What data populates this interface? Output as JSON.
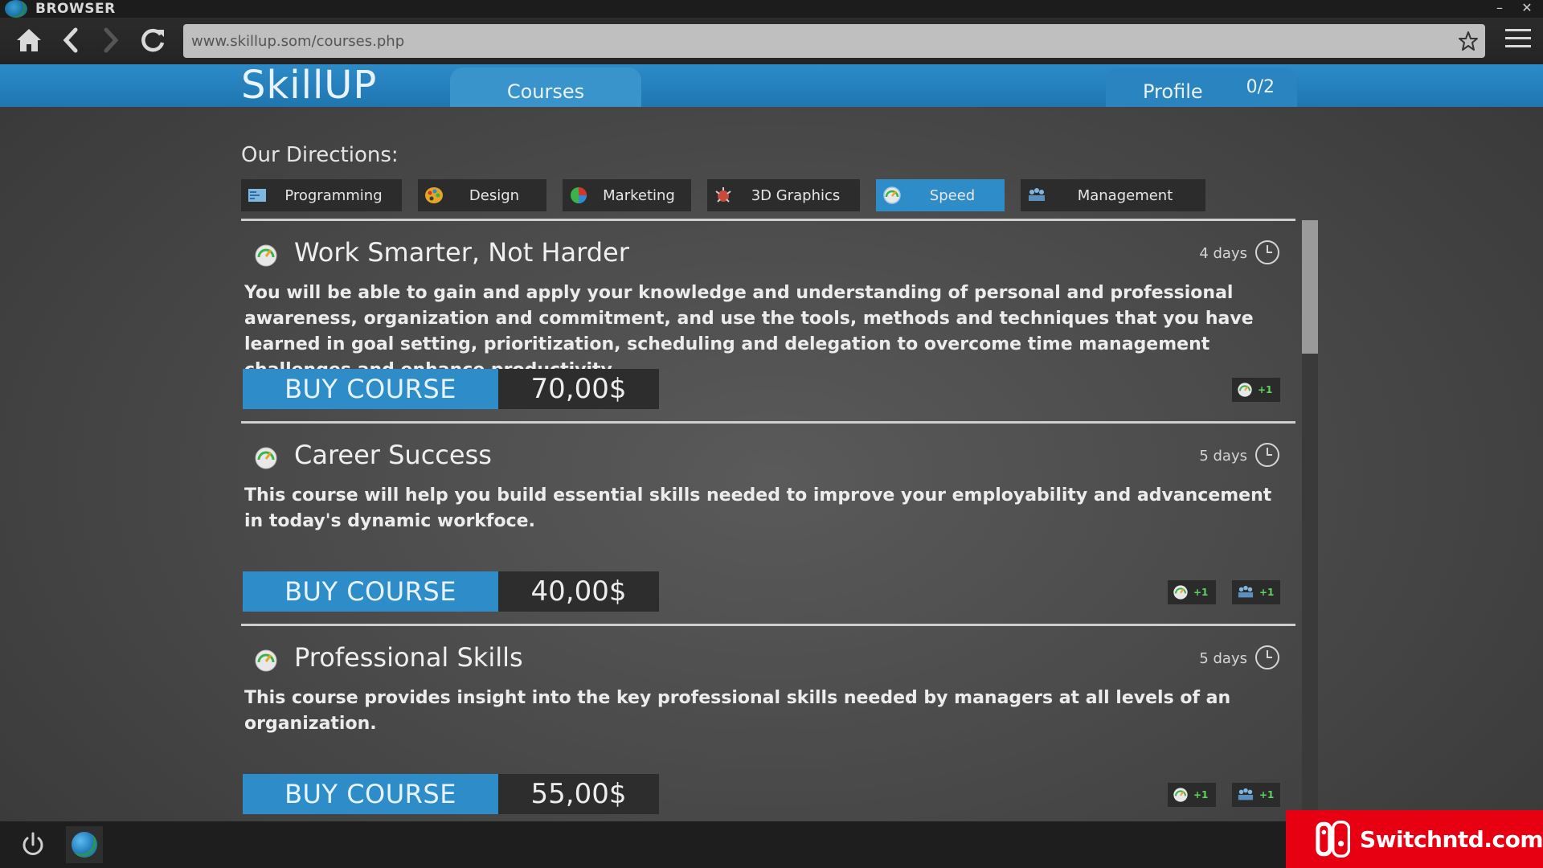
{
  "window": {
    "title": "BROWSER",
    "minimize_glyph": "–",
    "close_glyph": "✕"
  },
  "browser": {
    "url": "www.skillup.som/courses.php",
    "icons": [
      "home-icon",
      "back-icon",
      "forward-icon",
      "reload-icon",
      "star-icon",
      "menu-icon"
    ]
  },
  "site": {
    "logo": "SkillUP",
    "tabs": {
      "courses": "Courses",
      "profile": "Profile",
      "profile_count": "0/2"
    },
    "accent_color": "#2e8cc9"
  },
  "directions": {
    "title": "Our Directions:",
    "items": [
      {
        "label": "Programming",
        "icon": "programming-icon",
        "active": false
      },
      {
        "label": "Design",
        "icon": "palette-icon",
        "active": false
      },
      {
        "label": "Marketing",
        "icon": "pie-chart-icon",
        "active": false
      },
      {
        "label": "3D Graphics",
        "icon": "3d-graphics-icon",
        "active": false
      },
      {
        "label": "Speed",
        "icon": "speedometer-icon",
        "active": true
      },
      {
        "label": "Management",
        "icon": "team-icon",
        "active": false
      }
    ]
  },
  "courses": [
    {
      "title": "Work Smarter, Not Harder",
      "duration": "4 days",
      "description": "You will be able to gain and apply your knowledge and understanding of personal and professional awareness, organization and commitment, and use the tools, methods and techniques that you have learned in goal setting, prioritization, scheduling and delegation to overcome time management challenges and enhance productivity.",
      "buy_label": "BUY COURSE",
      "price": "70,00$",
      "perks": [
        {
          "icon": "speedometer-icon",
          "label": "+1"
        }
      ]
    },
    {
      "title": "Career Success",
      "duration": "5 days",
      "description": "This course will help you build essential skills needed to improve your employability and advancement in today's dynamic workfoce.",
      "buy_label": "BUY COURSE",
      "price": "40,00$",
      "perks": [
        {
          "icon": "speedometer-icon",
          "label": "+1"
        },
        {
          "icon": "team-icon",
          "label": "+1"
        }
      ]
    },
    {
      "title": "Professional Skills",
      "duration": "5 days",
      "description": "This course provides insight into the key professional skills needed by managers at all levels of an organization.",
      "buy_label": "BUY COURSE",
      "price": "55,00$",
      "perks": [
        {
          "icon": "speedometer-icon",
          "label": "+1"
        },
        {
          "icon": "team-icon",
          "label": "+1"
        }
      ]
    }
  ],
  "watermark": {
    "text": "Switchntd.com"
  }
}
